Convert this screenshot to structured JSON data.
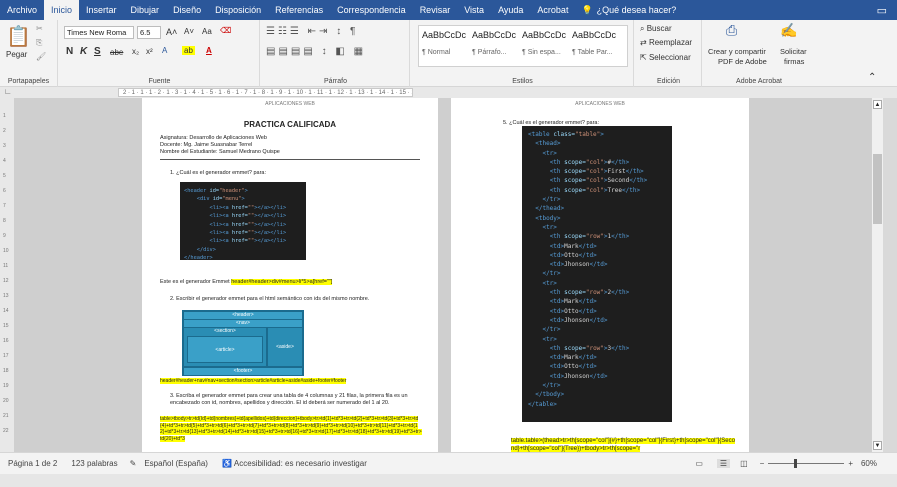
{
  "tabs": [
    "Archivo",
    "Inicio",
    "Insertar",
    "Dibujar",
    "Diseño",
    "Disposición",
    "Referencias",
    "Correspondencia",
    "Revisar",
    "Vista",
    "Ayuda",
    "Acrobat"
  ],
  "tellme": "¿Qué desea hacer?",
  "ribbon": {
    "clipboard": {
      "paste": "Pegar",
      "label": "Portapapeles"
    },
    "font": {
      "name": "Times New Roma",
      "size": "6.5",
      "label": "Fuente",
      "bold": "N",
      "italic": "K",
      "under": "S",
      "strike": "abe"
    },
    "paragraph": {
      "label": "Párrafo"
    },
    "styles": {
      "label": "Estilos",
      "items": [
        {
          "sample": "AaBbCcDc",
          "name": "¶ Normal"
        },
        {
          "sample": "AaBbCcDc",
          "name": "¶ Párrafo..."
        },
        {
          "sample": "AaBbCcDc",
          "name": "¶ Sin espa..."
        },
        {
          "sample": "AaBbCcDc",
          "name": "¶ Table Par..."
        }
      ]
    },
    "editing": {
      "label": "Edición",
      "find": "Buscar",
      "replace": "Reemplazar",
      "select": "Seleccionar"
    },
    "acrobat": {
      "label": "Adobe Acrobat",
      "create1": "Crear y compartir",
      "create2": "PDF de Adobe",
      "sign1": "Solicitar",
      "sign2": "firmas"
    }
  },
  "ruler": "2 · 1 · 1 · 1 · 2 · 1 · 3 · 1 · 4 · 1 · 5 · 1 · 6 · 1 · 7 · 1 · 8 · 1 · 9 · 1 · 10 · 1 · 11 · 1 · 12 · 1 · 13 · 1 · 14 · 1 · 15 · 16 · 17 · 18",
  "page1": {
    "header": "APLICACIONES WEB",
    "title": "PRACTICA CALIFICADA",
    "info": [
      "Asignatura: Desarrollo de Aplicaciones Web",
      "Docente: Mg. Jaime Suasnabar Terrel",
      "Nombre del Estudiante: Samuel Medrano Quispe"
    ],
    "q1": "1.   ¿Cuál es el generador emmet? para:",
    "code1": [
      "<header id=\"header\">",
      "    <div id=\"menu\">",
      "        <li><a href=\"\"></a></li>",
      "        <li><a href=\"\"></a></li>",
      "        <li><a href=\"\"></a></li>",
      "        <li><a href=\"\"></a></li>",
      "        <li><a href=\"\"></a></li>",
      "    </div>",
      "</header>"
    ],
    "a1_text": "Este es el generador Emmet",
    "a1_code": "header#header>div#menu>li*5>a[href=\"\"]",
    "q2": "2.   Escribir el generador emmet para el html semántico con ids del mismo nombre.",
    "diagram": {
      "header": "<header>",
      "nav": "<nav>",
      "section": "<section>",
      "article": "<article>",
      "aside": "<aside>",
      "footer": "<footer>"
    },
    "a2": "header#header+nav#nav+section#section>article#article+aside#aside+footer#footer",
    "q3": "3.   Escriba el generador emmet para crear una tabla de 4 columnas y 21 filas, la primera fila es un encabezado con id, nombres, apellidos y dirección. El id deberá ser numerado del 1 al 20.",
    "a3": "table>tbody>tr>td{Id}+td{nombres}+td{apellidos}+td{direccion}+tbody>tr>td{1}+td*3+tr>td{2}+td*3+tr>td{3}+td*3+tr>td{4}+td*3+tr>td{5}+td*3+tr>td{6}+td*3+tr>td{7}+td*3+tr>td{8}+td*3+tr>td{9}+td*3+tr>td{10}+td*3+tr>td{11}+td*3+tr>td{12}+td*3+tr>td{13}+td*3+tr>td{14}+td*3+tr>td{15}+td*3+tr>td{16}+td*3+tr>td{17}+td*3+tr>td{18}+td*3+tr>td{19}+td*3+tr>td{20}+td*3"
  },
  "page2": {
    "header": "APLICACIONES WEB",
    "q5": "5.   ¿Cuál es el generador emmet? para:",
    "code": [
      "<table class=\"table\">",
      "  <thead>",
      "    <tr>",
      "      <th scope=\"col\">#</th>",
      "      <th scope=\"col\">First</th>",
      "      <th scope=\"col\">Second</th>",
      "      <th scope=\"col\">Tree</th>",
      "    </tr>",
      "  </thead>",
      "  <tbody>",
      "    <tr>",
      "      <th scope=\"row\">1</th>",
      "      <td>Mark</td>",
      "      <td>Otto</td>",
      "      <td>Jhonson</td>",
      "    </tr>",
      "    <tr>",
      "      <th scope=\"row\">2</th>",
      "      <td>Mark</td>",
      "      <td>Otto</td>",
      "      <td>Jhonson</td>",
      "    </tr>",
      "    <tr>",
      "      <th scope=\"row\">3</th>",
      "      <td>Mark</td>",
      "      <td>Otto</td>",
      "      <td>Jhonson</td>",
      "    </tr>",
      "  </tbody>",
      "</table>"
    ],
    "answer": "table.table>(thead>tr>th[scope=\"col\"]{#}+th[scope=\"col\"]{First}+th[scope=\"col\"]{Second}+th[scope=\"col\"]{Tree})+tbody>tr>th[scope=\"r"
  },
  "status": {
    "page": "Página 1 de 2",
    "words": "123 palabras",
    "lang": "Español (España)",
    "access": "Accesibilidad: es necesario investigar",
    "zoom": "60%"
  }
}
